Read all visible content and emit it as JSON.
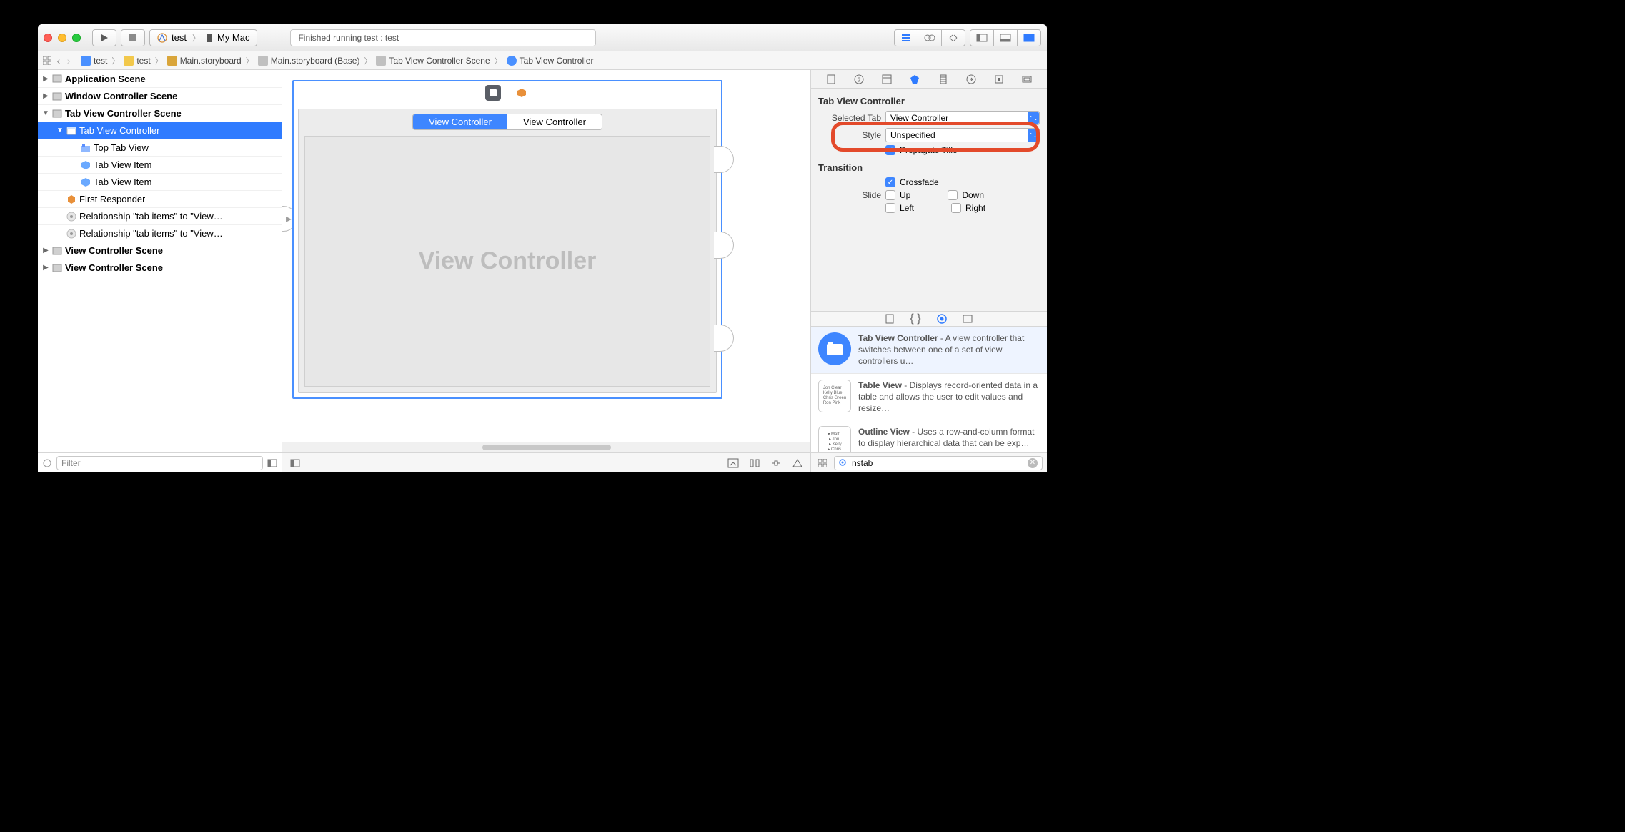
{
  "toolbar": {
    "scheme_name": "test",
    "scheme_dest": "My Mac",
    "status": "Finished running test : test"
  },
  "breadcrumbs": [
    "test",
    "test",
    "Main.storyboard",
    "Main.storyboard (Base)",
    "Tab View Controller Scene",
    "Tab View Controller"
  ],
  "outline": {
    "items": [
      {
        "label": "Application Scene",
        "depth": 0,
        "tri": "▶",
        "bold": true,
        "icon": "scene"
      },
      {
        "label": "Window Controller Scene",
        "depth": 0,
        "tri": "▶",
        "bold": true,
        "icon": "scene"
      },
      {
        "label": "Tab View Controller Scene",
        "depth": 0,
        "tri": "▼",
        "bold": true,
        "icon": "scene"
      },
      {
        "label": "Tab View Controller",
        "depth": 1,
        "tri": "▼",
        "sel": true,
        "icon": "tvc"
      },
      {
        "label": "Top Tab View",
        "depth": 2,
        "icon": "tabview"
      },
      {
        "label": "Tab View Item",
        "depth": 2,
        "icon": "cube"
      },
      {
        "label": "Tab View Item",
        "depth": 2,
        "icon": "cube"
      },
      {
        "label": "First Responder",
        "depth": 1,
        "icon": "responder"
      },
      {
        "label": "Relationship \"tab items\" to \"View…",
        "depth": 1,
        "icon": "rel"
      },
      {
        "label": "Relationship \"tab items\" to \"View…",
        "depth": 1,
        "icon": "rel"
      },
      {
        "label": "View Controller Scene",
        "depth": 0,
        "tri": "▶",
        "bold": true,
        "icon": "scene"
      },
      {
        "label": "View Controller Scene",
        "depth": 0,
        "tri": "▶",
        "bold": true,
        "icon": "scene"
      }
    ],
    "filter_placeholder": "Filter"
  },
  "canvas": {
    "tabs": [
      "View Controller",
      "View Controller"
    ],
    "active_tab": 0,
    "content_placeholder": "View Controller"
  },
  "inspector": {
    "section": "Tab View Controller",
    "selected_tab_label": "Selected Tab",
    "selected_tab_value": "View Controller",
    "style_label": "Style",
    "style_value": "Unspecified",
    "propagate_label": "Propagate Title",
    "transition_label": "Transition",
    "crossfade_label": "Crossfade",
    "slide_label": "Slide",
    "slide_opts": [
      "Up",
      "Down",
      "Left",
      "Right"
    ]
  },
  "library": {
    "items": [
      {
        "title": "Tab View Controller",
        "desc": " - A view controller that switches between one of a set of view controllers u…",
        "sel": true,
        "icon": "tvc"
      },
      {
        "title": "Table View",
        "desc": " - Displays record-oriented data in a table and allows the user to edit values and resize…",
        "icon": "table"
      },
      {
        "title": "Outline View",
        "desc": " - Uses a row-and-column format to display hierarchical data that can be exp…",
        "icon": "outline"
      }
    ],
    "search_value": "nstab"
  }
}
